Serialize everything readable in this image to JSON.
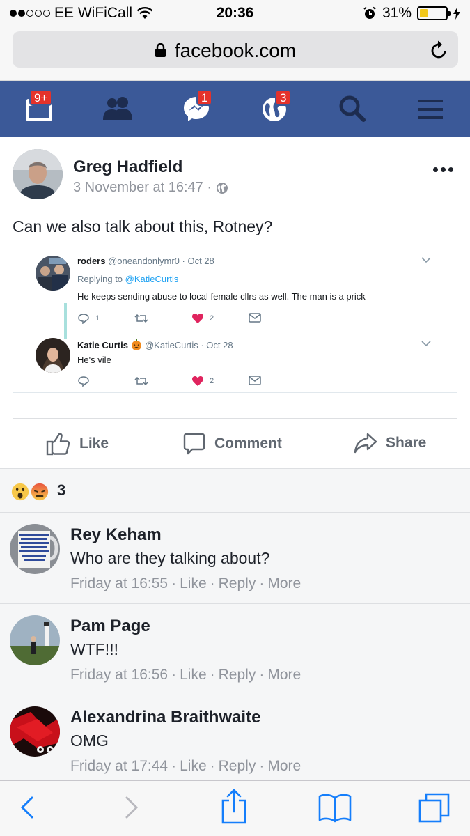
{
  "status": {
    "carrier": "EE WiFiCall",
    "time": "20:36",
    "battery": "31%",
    "battery_level": 0.31
  },
  "browser": {
    "url": "facebook.com"
  },
  "fb_nav": {
    "notifications_badge": "9+",
    "messages_badge": "1",
    "globe_badge": "3"
  },
  "post": {
    "author": "Greg Hadfield",
    "timestamp": "3 November at 16:47 ·",
    "text": "Can we also talk about this, Rotney?",
    "embedded_tweets": [
      {
        "name": "roders",
        "handle": "@oneandonlymr0 · Oct 28",
        "replying_prefix": "Replying to ",
        "replying_to": "@KatieCurtis",
        "text": "He keeps sending abuse to local female cllrs as well. The man is a prick",
        "replies": "1",
        "likes": "2"
      },
      {
        "name": "Katie Curtis",
        "handle": "@KatieCurtis · Oct 28",
        "text": "He's vile",
        "replies": "",
        "likes": "2"
      }
    ],
    "actions": {
      "like": "Like",
      "comment": "Comment",
      "share": "Share"
    },
    "reaction_count": "3"
  },
  "comments": [
    {
      "name": "Rey Keham",
      "text": "Who are they talking about?",
      "time": "Friday at 16:55",
      "like": "Like",
      "reply": "Reply",
      "more": "More"
    },
    {
      "name": "Pam Page",
      "text": "WTF!!!",
      "time": "Friday at 16:56",
      "like": "Like",
      "reply": "Reply",
      "more": "More"
    },
    {
      "name": "Alexandrina Braithwaite",
      "text": "OMG",
      "time": "Friday at 17:44",
      "like": "Like",
      "reply": "Reply",
      "more": "More"
    }
  ],
  "colors": {
    "fb_blue": "#3b5998",
    "badge_red": "#e4322b",
    "ios_blue": "#157efb",
    "battery_yellow": "#f2c81b"
  }
}
